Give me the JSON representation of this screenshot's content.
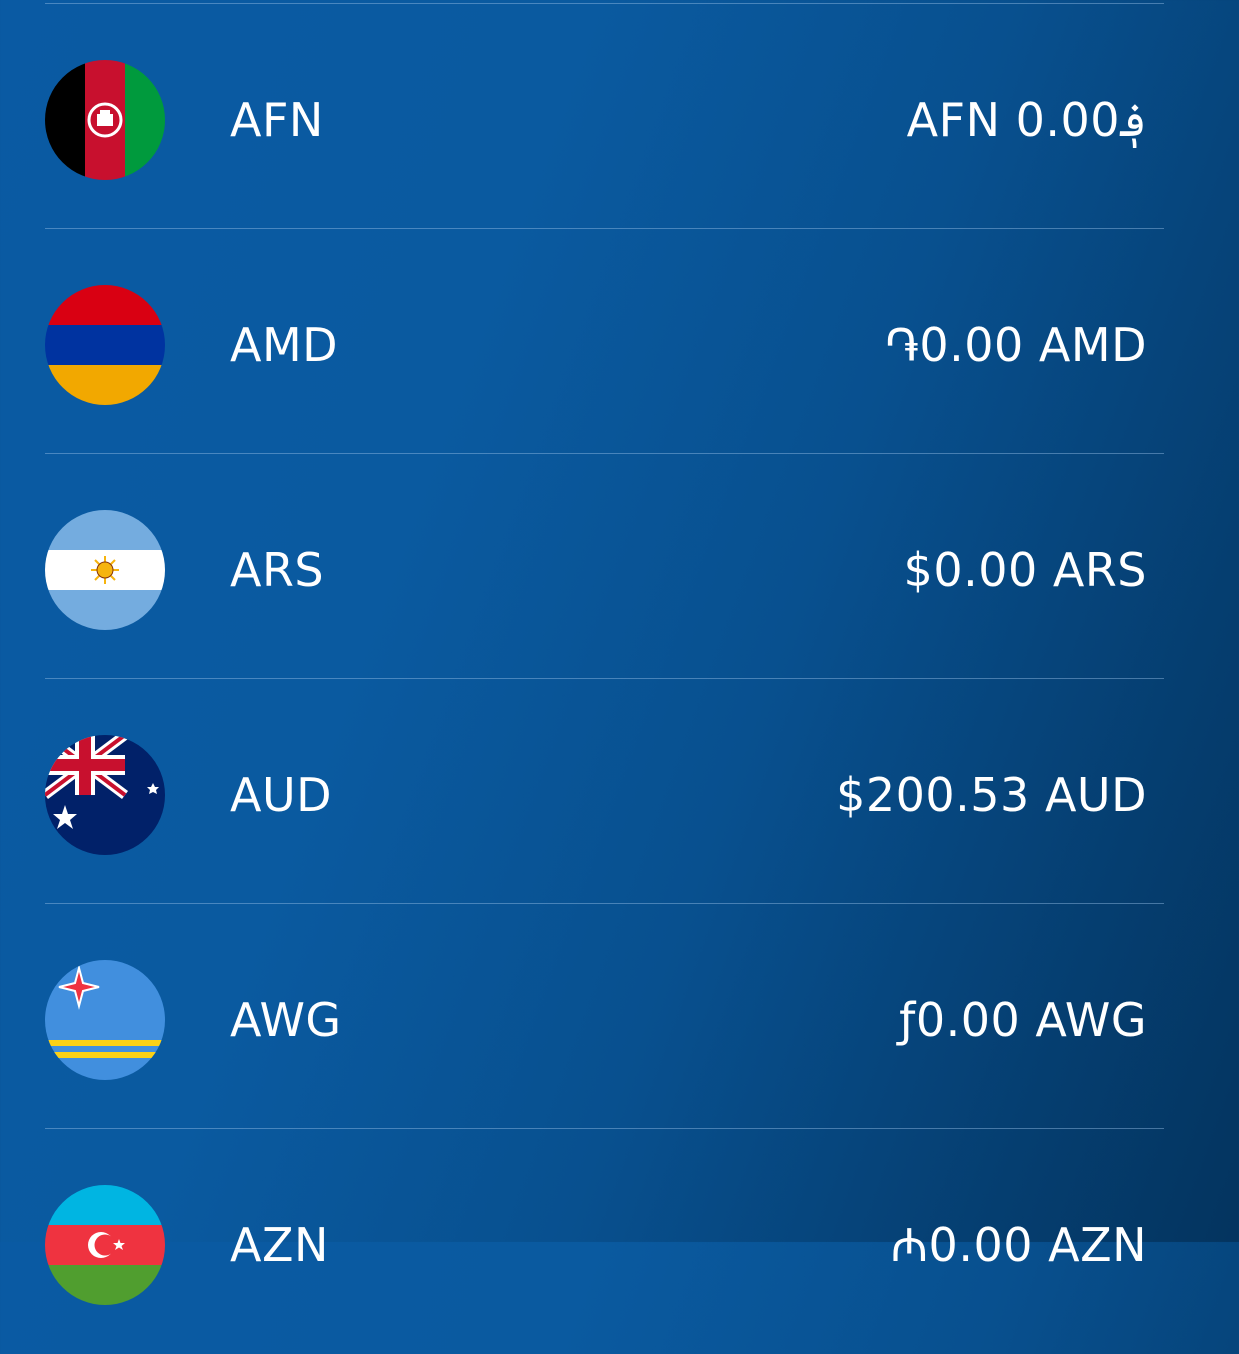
{
  "currencies": [
    {
      "code": "AFN",
      "balance": "AFN 0.00؋",
      "flag": "afghanistan-flag-icon"
    },
    {
      "code": "AMD",
      "balance": "֏0.00 AMD",
      "flag": "armenia-flag-icon"
    },
    {
      "code": "ARS",
      "balance": "$0.00 ARS",
      "flag": "argentina-flag-icon"
    },
    {
      "code": "AUD",
      "balance": "$200.53 AUD",
      "flag": "australia-flag-icon"
    },
    {
      "code": "AWG",
      "balance": "ƒ0.00 AWG",
      "flag": "aruba-flag-icon"
    },
    {
      "code": "AZN",
      "balance": "₼0.00 AZN",
      "flag": "azerbaijan-flag-icon"
    }
  ],
  "colors": {
    "background_start": "#0a5aa3",
    "background_end": "#04345f",
    "divider": "#5f8fc0",
    "text": "#ffffff"
  }
}
